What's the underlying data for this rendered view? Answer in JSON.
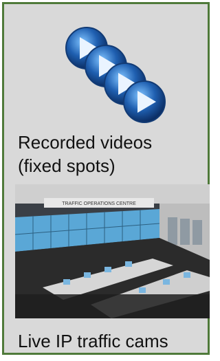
{
  "recorded": {
    "label_line1": "Recorded videos",
    "label_line2": "(fixed spots)",
    "icon": "play-stack-icon"
  },
  "live": {
    "image_sign": "TRAFFIC OPERATIONS CENTRE",
    "label": "Live IP traffic cams"
  },
  "colors": {
    "border": "#4f7a3a",
    "panel": "#d9d9d9",
    "play_blue": "#1f5fb0"
  }
}
